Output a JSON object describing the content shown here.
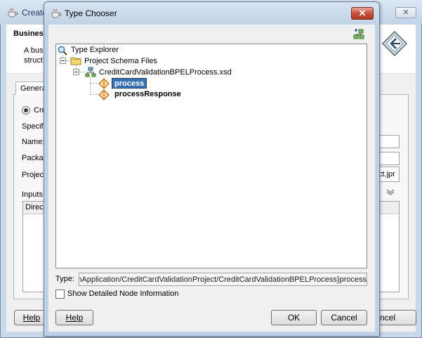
{
  "background_window": {
    "title": "Create",
    "close_label": "✕",
    "header_title": "Busines",
    "header_desc_line1": "A bus",
    "header_desc_line2": "struct",
    "tab_label": "Genera",
    "radio_label": "Cre",
    "specify_label": "Specif",
    "name_label": "Name:",
    "package_label": "Packag",
    "project_label": "Projec",
    "project_value": "ct.jpr",
    "inputs_label": "Inputs",
    "table_header": "Direc",
    "help_label": "Help",
    "cancel_label": "ncel"
  },
  "dialog": {
    "title": "Type Chooser",
    "close_label": "✕",
    "tree": {
      "root": "Type Explorer",
      "folder": "Project Schema Files",
      "file": "CreditCardValidationBPELProcess.xsd",
      "elements": [
        {
          "label": "process",
          "selected": true
        },
        {
          "label": "processResponse",
          "selected": false
        }
      ]
    },
    "type_label": "Type:",
    "type_value": "ionApplication/CreditCardValidationProject/CreditCardValidationBPELProcess}process",
    "show_detail_label": "Show Detailed Node Information",
    "show_detail_checked": false,
    "buttons": {
      "help": "Help",
      "ok": "OK",
      "cancel": "Cancel"
    }
  },
  "colors": {
    "selection": "#3573b6",
    "title_bar": "#c3d4e8",
    "close_red": "#c7503c",
    "element_icon": "#e07a1f"
  },
  "icons": {
    "title": "coffee-cup-icon",
    "new_type": "new-type-icon",
    "explorer": "magnifier-icon",
    "folder": "folder-icon",
    "schema": "xsd-schema-icon",
    "element": "element-icon"
  }
}
